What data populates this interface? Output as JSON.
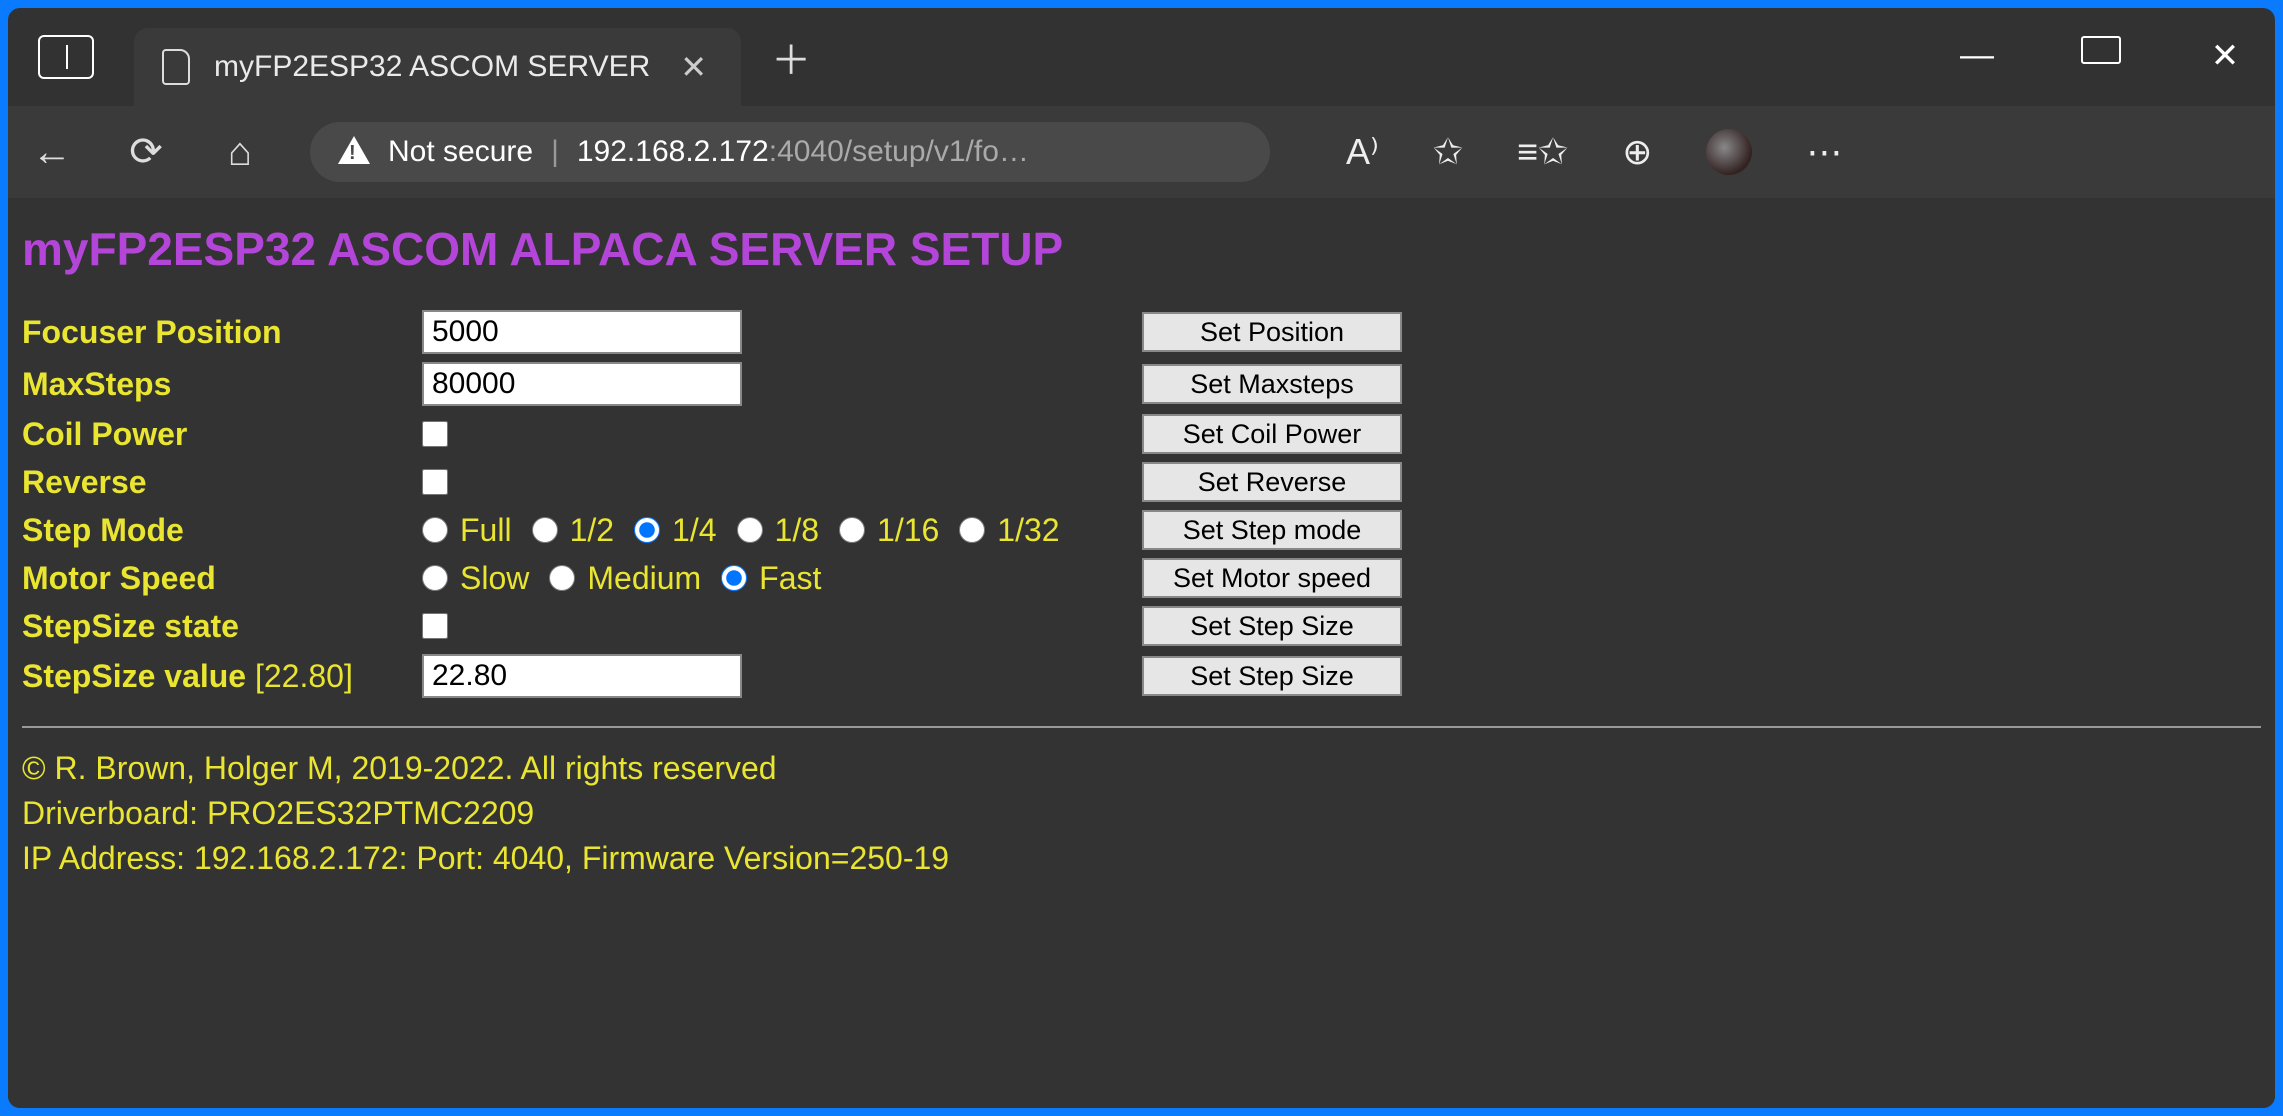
{
  "browser": {
    "tab_title": "myFP2ESP32 ASCOM SERVER",
    "security_label": "Not secure",
    "url_host": "192.168.2.172",
    "url_rest": ":4040/setup/v1/fo…"
  },
  "page": {
    "heading": "myFP2ESP32 ASCOM ALPACA SERVER SETUP"
  },
  "form": {
    "focuser_position": {
      "label": "Focuser Position",
      "value": "5000",
      "button": "Set Position"
    },
    "max_steps": {
      "label": "MaxSteps",
      "value": "80000",
      "button": "Set Maxsteps"
    },
    "coil_power": {
      "label": "Coil Power",
      "button": "Set Coil Power"
    },
    "reverse": {
      "label": "Reverse",
      "button": "Set Reverse"
    },
    "step_mode": {
      "label": "Step Mode",
      "options": {
        "full": "Full",
        "half": "1/2",
        "quarter": "1/4",
        "eighth": "1/8",
        "sixteenth": "1/16",
        "thirtysecond": "1/32"
      },
      "button": "Set Step mode"
    },
    "motor_speed": {
      "label": "Motor Speed",
      "options": {
        "slow": "Slow",
        "medium": "Medium",
        "fast": "Fast"
      },
      "button": "Set Motor speed"
    },
    "stepsize_state": {
      "label": "StepSize state",
      "button": "Set Step Size"
    },
    "stepsize_value": {
      "label": "StepSize value",
      "annot": "[22.80]",
      "value": "22.80",
      "button": "Set Step Size"
    }
  },
  "footer": {
    "copyright": "© R. Brown, Holger M, 2019-2022. All rights reserved",
    "driverboard": "Driverboard: PRO2ES32PTMC2209",
    "network": "IP Address: 192.168.2.172: Port: 4040, Firmware Version=250-19"
  }
}
